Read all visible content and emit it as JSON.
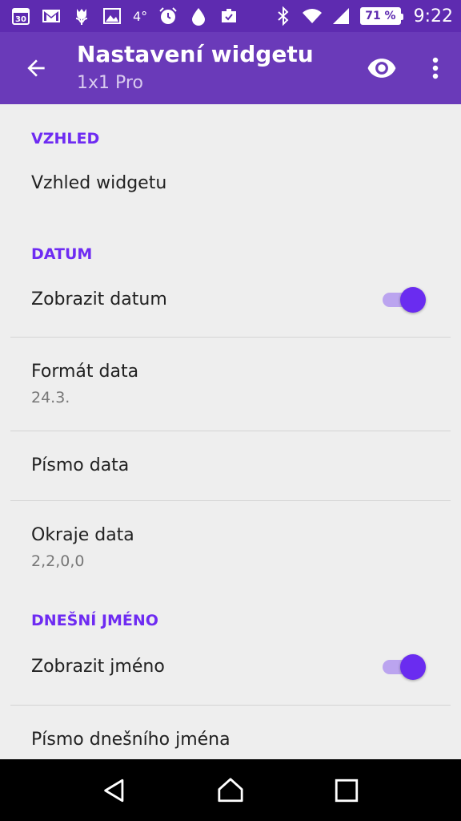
{
  "status_bar": {
    "calendar_day": "30",
    "temperature": "4°",
    "battery": "71 %",
    "time": "9:22"
  },
  "app_bar": {
    "title": "Nastavení widgetu",
    "subtitle": "1x1 Pro"
  },
  "sections": {
    "appearance": {
      "header": "VZHLED",
      "widget_appearance": "Vzhled widgetu"
    },
    "date": {
      "header": "DATUM",
      "show_date": "Zobrazit datum",
      "show_date_on": true,
      "date_format": "Formát data",
      "date_format_value": "24.3.",
      "date_font": "Písmo data",
      "date_margins": "Okraje data",
      "date_margins_value": "2,2,0,0"
    },
    "todays_name": {
      "header": "DNEŠNÍ JMÉNO",
      "show_name": "Zobrazit jméno",
      "show_name_on": true,
      "name_font": "Písmo dnešního jména"
    }
  },
  "colors": {
    "status_bar": "#5e2bb0",
    "app_bar": "#6a3ab9",
    "accent": "#6e2bf2",
    "background": "#eeeeee"
  }
}
